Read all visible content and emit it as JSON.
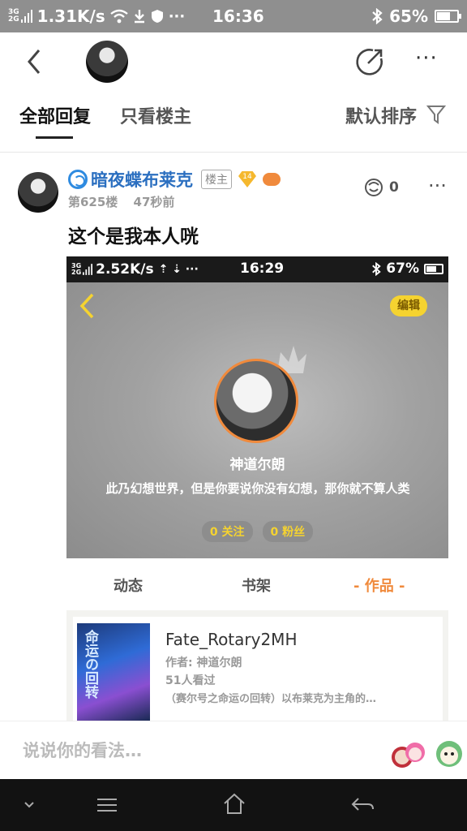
{
  "status_bar": {
    "network_top": "3G",
    "network_bottom": "2G",
    "speed": "1.31K/s",
    "time": "16:36",
    "battery": "65%",
    "battery_level": 0.65
  },
  "nav": {
    "back_icon": "back-arrow-icon",
    "share_icon": "share-icon",
    "more_icon": "more-icon"
  },
  "tabs": {
    "all_replies": "全部回复",
    "owner_only": "只看楼主",
    "sort": "默认排序"
  },
  "post": {
    "username": "暗夜蝶布莱克",
    "owner_badge": "楼主",
    "level": "14",
    "floor": "第625楼",
    "time_ago": "47秒前",
    "like_count": "0",
    "text": "这个是我本人咣"
  },
  "embedded": {
    "status": {
      "network_top": "3G",
      "network_bottom": "2G",
      "speed": "2.52K/s",
      "time": "16:29",
      "battery": "67%",
      "battery_level": 0.67
    },
    "edit_button": "编辑",
    "profile_name": "神道尔朗",
    "bio": "此乃幻想世界，但是你要说你没有幻想，那你就不算人类",
    "following": "0 关注",
    "followers": "0 粉丝",
    "tabs": [
      "动态",
      "书架",
      "- 作品 -"
    ],
    "work": {
      "cover_title": "命运の回转",
      "title": "Fate_Rotary2MH",
      "author": "作者: 神道尔朗",
      "views": "51人看过",
      "desc": "（赛尔号之命运の回转）以布莱克为主角的…"
    }
  },
  "comment": {
    "placeholder": "说说你的看法…"
  },
  "colors": {
    "accent_orange": "#f08a3c",
    "username_blue": "#2b6fc0",
    "edit_yellow": "#f5d330"
  }
}
